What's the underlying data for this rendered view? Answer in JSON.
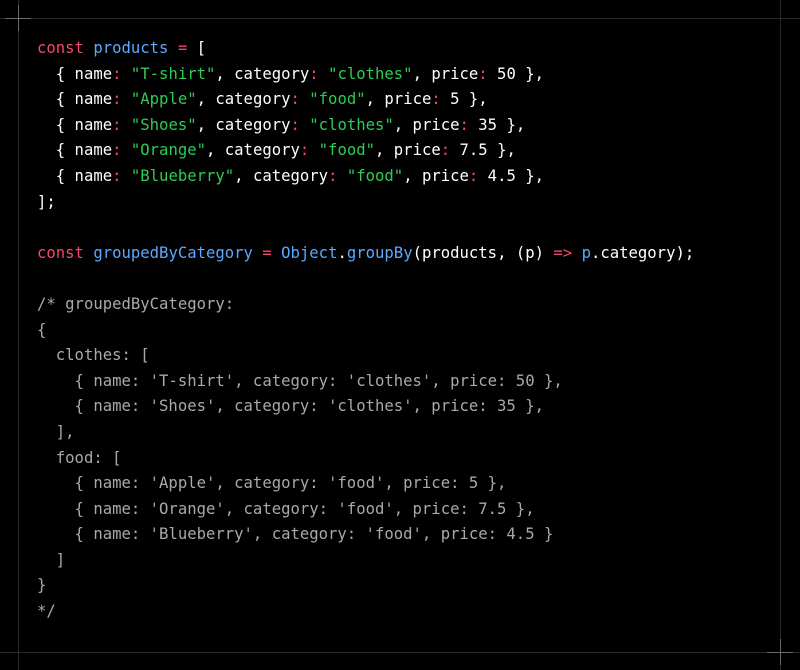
{
  "code_block": {
    "lines": [
      [
        {
          "t": "k",
          "x": "const"
        },
        {
          "t": "p",
          "x": " "
        },
        {
          "t": "v",
          "x": "products"
        },
        {
          "t": "p",
          "x": " "
        },
        {
          "t": "k",
          "x": "="
        },
        {
          "t": "p",
          "x": " ["
        }
      ],
      [
        {
          "t": "p",
          "x": "  { name"
        },
        {
          "t": "k",
          "x": ":"
        },
        {
          "t": "p",
          "x": " "
        },
        {
          "t": "s",
          "x": "\"T-shirt\""
        },
        {
          "t": "p",
          "x": ", category"
        },
        {
          "t": "k",
          "x": ":"
        },
        {
          "t": "p",
          "x": " "
        },
        {
          "t": "s",
          "x": "\"clothes\""
        },
        {
          "t": "p",
          "x": ", price"
        },
        {
          "t": "k",
          "x": ":"
        },
        {
          "t": "p",
          "x": " 50 },"
        }
      ],
      [
        {
          "t": "p",
          "x": "  { name"
        },
        {
          "t": "k",
          "x": ":"
        },
        {
          "t": "p",
          "x": " "
        },
        {
          "t": "s",
          "x": "\"Apple\""
        },
        {
          "t": "p",
          "x": ", category"
        },
        {
          "t": "k",
          "x": ":"
        },
        {
          "t": "p",
          "x": " "
        },
        {
          "t": "s",
          "x": "\"food\""
        },
        {
          "t": "p",
          "x": ", price"
        },
        {
          "t": "k",
          "x": ":"
        },
        {
          "t": "p",
          "x": " 5 },"
        }
      ],
      [
        {
          "t": "p",
          "x": "  { name"
        },
        {
          "t": "k",
          "x": ":"
        },
        {
          "t": "p",
          "x": " "
        },
        {
          "t": "s",
          "x": "\"Shoes\""
        },
        {
          "t": "p",
          "x": ", category"
        },
        {
          "t": "k",
          "x": ":"
        },
        {
          "t": "p",
          "x": " "
        },
        {
          "t": "s",
          "x": "\"clothes\""
        },
        {
          "t": "p",
          "x": ", price"
        },
        {
          "t": "k",
          "x": ":"
        },
        {
          "t": "p",
          "x": " 35 },"
        }
      ],
      [
        {
          "t": "p",
          "x": "  { name"
        },
        {
          "t": "k",
          "x": ":"
        },
        {
          "t": "p",
          "x": " "
        },
        {
          "t": "s",
          "x": "\"Orange\""
        },
        {
          "t": "p",
          "x": ", category"
        },
        {
          "t": "k",
          "x": ":"
        },
        {
          "t": "p",
          "x": " "
        },
        {
          "t": "s",
          "x": "\"food\""
        },
        {
          "t": "p",
          "x": ", price"
        },
        {
          "t": "k",
          "x": ":"
        },
        {
          "t": "p",
          "x": " 7.5 },"
        }
      ],
      [
        {
          "t": "p",
          "x": "  { name"
        },
        {
          "t": "k",
          "x": ":"
        },
        {
          "t": "p",
          "x": " "
        },
        {
          "t": "s",
          "x": "\"Blueberry\""
        },
        {
          "t": "p",
          "x": ", category"
        },
        {
          "t": "k",
          "x": ":"
        },
        {
          "t": "p",
          "x": " "
        },
        {
          "t": "s",
          "x": "\"food\""
        },
        {
          "t": "p",
          "x": ", price"
        },
        {
          "t": "k",
          "x": ":"
        },
        {
          "t": "p",
          "x": " 4.5 },"
        }
      ],
      [
        {
          "t": "p",
          "x": "];"
        }
      ],
      [],
      [
        {
          "t": "k",
          "x": "const"
        },
        {
          "t": "p",
          "x": " "
        },
        {
          "t": "v",
          "x": "groupedByCategory"
        },
        {
          "t": "p",
          "x": " "
        },
        {
          "t": "k",
          "x": "="
        },
        {
          "t": "p",
          "x": " "
        },
        {
          "t": "v",
          "x": "Object"
        },
        {
          "t": "p",
          "x": "."
        },
        {
          "t": "v",
          "x": "groupBy"
        },
        {
          "t": "p",
          "x": "(products, (p) "
        },
        {
          "t": "k",
          "x": "=>"
        },
        {
          "t": "p",
          "x": " "
        },
        {
          "t": "v",
          "x": "p"
        },
        {
          "t": "p",
          "x": ".category);"
        }
      ],
      [],
      [
        {
          "t": "c",
          "x": "/* groupedByCategory:"
        }
      ],
      [
        {
          "t": "c",
          "x": "{"
        }
      ],
      [
        {
          "t": "c",
          "x": "  clothes: ["
        }
      ],
      [
        {
          "t": "c",
          "x": "    { name: 'T-shirt', category: 'clothes', price: 50 },"
        }
      ],
      [
        {
          "t": "c",
          "x": "    { name: 'Shoes', category: 'clothes', price: 35 },"
        }
      ],
      [
        {
          "t": "c",
          "x": "  ],"
        }
      ],
      [
        {
          "t": "c",
          "x": "  food: ["
        }
      ],
      [
        {
          "t": "c",
          "x": "    { name: 'Apple', category: 'food', price: 5 },"
        }
      ],
      [
        {
          "t": "c",
          "x": "    { name: 'Orange', category: 'food', price: 7.5 },"
        }
      ],
      [
        {
          "t": "c",
          "x": "    { name: 'Blueberry', category: 'food', price: 4.5 }"
        }
      ],
      [
        {
          "t": "c",
          "x": "  ]"
        }
      ],
      [
        {
          "t": "c",
          "x": "}"
        }
      ],
      [
        {
          "t": "c",
          "x": "*/"
        }
      ]
    ]
  },
  "colors": {
    "background": "#000000",
    "keyword": "#f7456e",
    "identifier": "#5aa9ff",
    "string": "#2ecc55",
    "comment": "#a9a9a9",
    "plain": "#ffffff"
  }
}
